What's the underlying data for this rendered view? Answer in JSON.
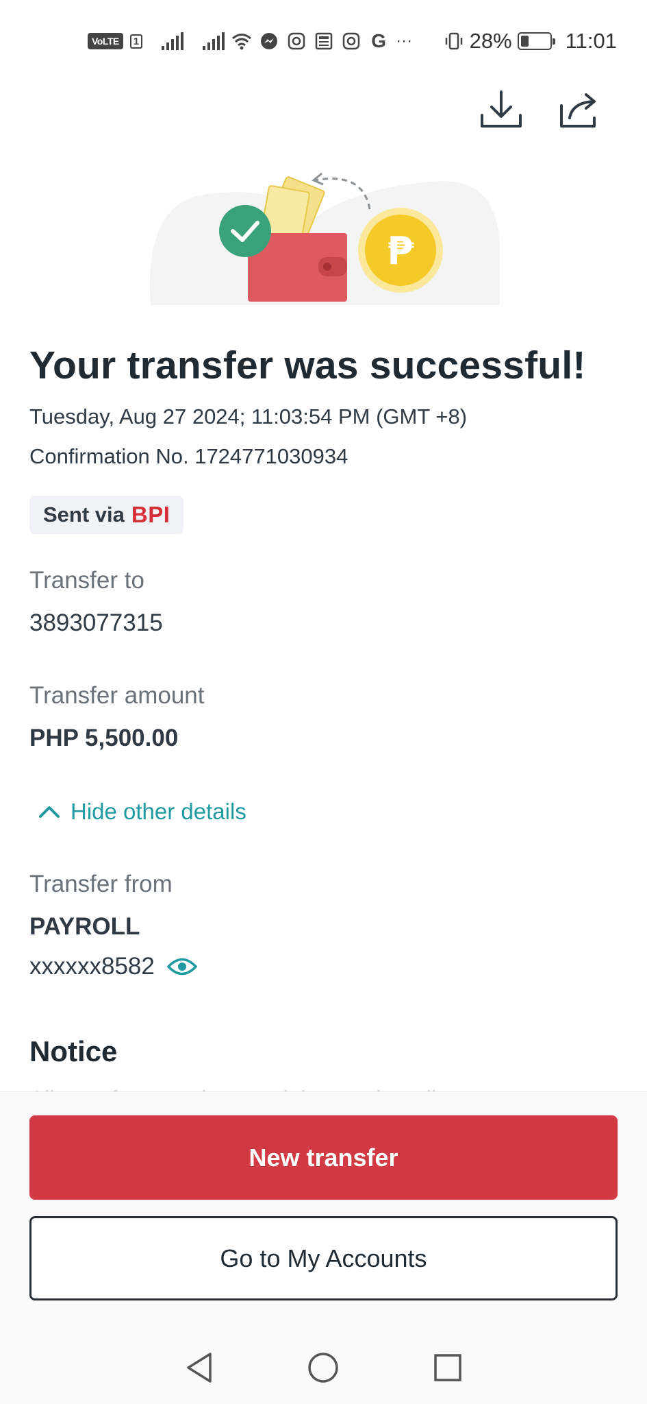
{
  "status_bar": {
    "volte": "VoLTE",
    "sim": "1",
    "battery_percent": "28%",
    "time": "11:01",
    "more": "···",
    "icons": [
      "signal-icon",
      "signal-icon",
      "wifi-icon",
      "messenger-icon",
      "instagram-icon",
      "news-icon",
      "instagram-icon",
      "google-icon",
      "vibrate-icon",
      "battery-icon"
    ]
  },
  "top_actions": {
    "icons": [
      "download-icon",
      "share-icon"
    ]
  },
  "receipt": {
    "title": "Your transfer was successful!",
    "datetime": "Tuesday, Aug 27 2024; 11:03:54 PM (GMT +8)",
    "confirmation": "Confirmation No. 1724771030934",
    "sent_via_label": "Sent via",
    "sent_via_bank": "BPI"
  },
  "details": {
    "transfer_to_label": "Transfer to",
    "transfer_to_value": "3893077315",
    "amount_label": "Transfer amount",
    "amount_value": "PHP 5,500.00",
    "toggle_label": "Hide other details",
    "from_label": "Transfer from",
    "from_account_name": "PAYROLL",
    "from_account_number": "xxxxxx8582"
  },
  "notice": {
    "title": "Notice",
    "text_partial": "All transfers are done real time and credit..."
  },
  "buttons": {
    "primary": "New transfer",
    "secondary": "Go to My Accounts"
  },
  "colors": {
    "accent_red": "#d13a42",
    "teal": "#1f9aa0",
    "bpi_red": "#d62e36"
  }
}
